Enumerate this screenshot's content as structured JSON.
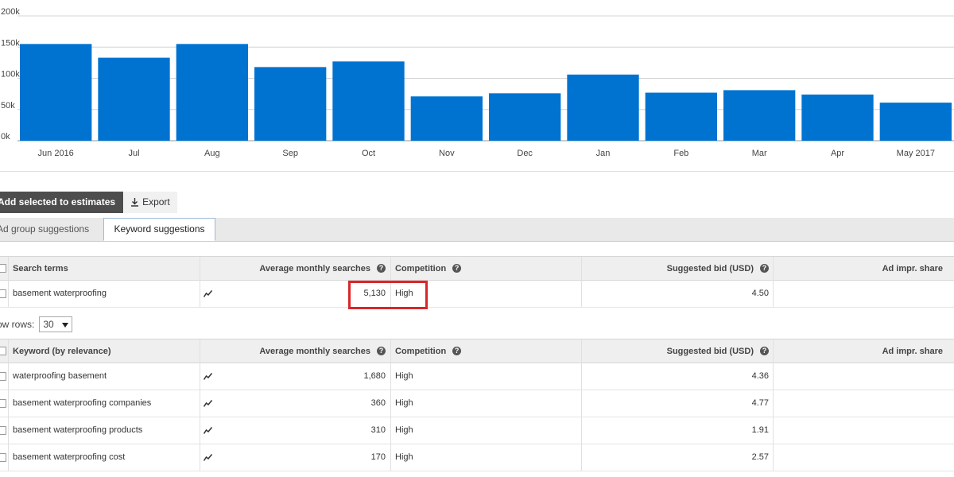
{
  "chart_data": {
    "type": "bar",
    "categories": [
      "Jun 2016",
      "Jul",
      "Aug",
      "Sep",
      "Oct",
      "Nov",
      "Dec",
      "Jan",
      "Feb",
      "Mar",
      "Apr",
      "May 2017"
    ],
    "values": [
      155000,
      133000,
      155000,
      118000,
      127000,
      71000,
      76000,
      106000,
      77000,
      81000,
      74000,
      61000
    ],
    "ylim": [
      0,
      200000
    ],
    "yticks": [
      0,
      50000,
      100000,
      150000,
      200000
    ],
    "ytick_labels": [
      "0k",
      "50k",
      "100k",
      "150k",
      "200k"
    ],
    "grid": true,
    "bar_color": "#0073d1"
  },
  "toolbar": {
    "add_label": "Add selected to estimates",
    "export_label": "Export"
  },
  "tabs": [
    {
      "label": "Ad group suggestions"
    },
    {
      "label": "Keyword suggestions"
    }
  ],
  "search_table": {
    "headers": {
      "term": "Search terms",
      "avg": "Average monthly searches",
      "competition": "Competition",
      "bid": "Suggested bid (USD)",
      "impr": "Ad impr. share"
    },
    "rows": [
      {
        "term": "basement waterproofing",
        "avg": "5,130",
        "competition": "High",
        "bid": "4.50",
        "impr": ""
      }
    ]
  },
  "show_rows": {
    "label": "ow rows:",
    "value": "30"
  },
  "keyword_table": {
    "headers": {
      "term": "Keyword (by relevance)",
      "avg": "Average monthly searches",
      "competition": "Competition",
      "bid": "Suggested bid (USD)",
      "impr": "Ad impr. share"
    },
    "rows": [
      {
        "term": "waterproofing basement",
        "avg": "1,680",
        "competition": "High",
        "bid": "4.36"
      },
      {
        "term": "basement waterproofing companies",
        "avg": "360",
        "competition": "High",
        "bid": "4.77"
      },
      {
        "term": "basement waterproofing products",
        "avg": "310",
        "competition": "High",
        "bid": "1.91"
      },
      {
        "term": "basement waterproofing cost",
        "avg": "170",
        "competition": "High",
        "bid": "2.57"
      }
    ]
  },
  "colors": {
    "highlight": "#d9262a",
    "header_bg": "#efefef"
  }
}
